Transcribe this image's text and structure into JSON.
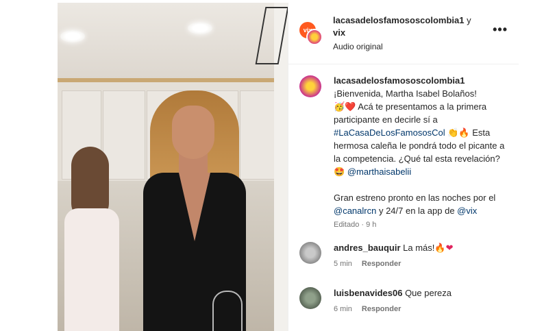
{
  "post": {
    "header": {
      "user_line1": "lacasadelosfamososcolombia1",
      "connector": " y",
      "user_line2": "vix",
      "audio": "Audio original",
      "more_label": "•••"
    },
    "caption": {
      "username": "lacasadelosfamososcolombia1",
      "line1": "¡Bienvenida, Martha Isabel Bolaños!",
      "line2_emoji": "🥳❤️",
      "line2_text": " Acá te presentamos a la primera participante en decirle sí a ",
      "hashtag": "#LaCasaDeLosFamososCol",
      "hashtag_emoji": " 👏🔥",
      "line3_text": " Esta hermosa caleña le pondrá todo el picante a la competencia. ¿Qué tal esta revelación? 🤩 ",
      "mention1": "@marthaisabelii",
      "para2_pre": "Gran estreno pronto en las noches por el ",
      "mention2": "@canalrcn",
      "para2_mid": " y 24/7 en la app de ",
      "mention3": "@vix",
      "meta": "Editado · 9 h"
    },
    "comments": [
      {
        "username": "andres_bauquir",
        "text": " La más!🔥",
        "heart": "❤",
        "time": "5 min",
        "reply": "Responder"
      },
      {
        "username": "luisbenavides06",
        "text": " Que pereza",
        "time": "6 min",
        "reply": "Responder"
      }
    ],
    "logo_text": "vix"
  }
}
